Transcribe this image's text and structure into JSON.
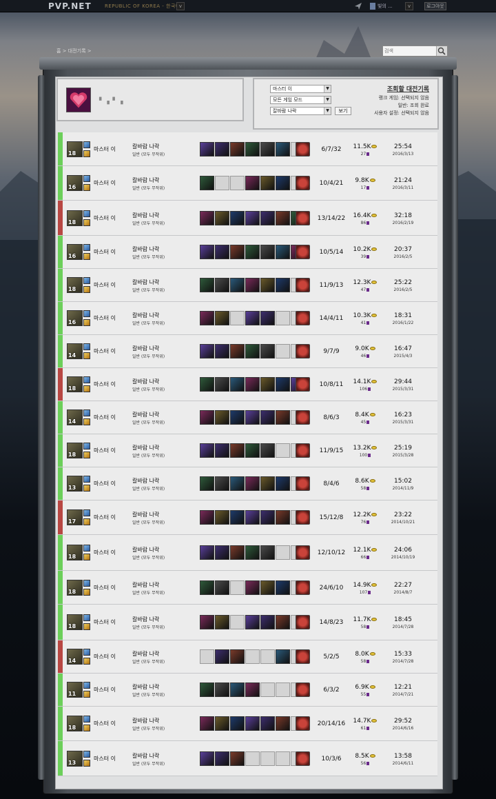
{
  "header": {
    "logo": "PVP.NET",
    "region": "REPUBLIC OF KOREA - 한국어",
    "region_dd": "v",
    "user_name": "빛의 ...",
    "user_dd": "v",
    "logout": "로그아웃"
  },
  "breadcrumb": "홈 > 대전기록 >",
  "search": {
    "placeholder": "검색"
  },
  "summoner": {
    "name": "▘▗▝ ▗"
  },
  "filters": {
    "champion": "마스터 이",
    "game_mode": "모든 게임 모드",
    "map": "칼바람 나락",
    "view_button": "보기",
    "title": "조회할 대전기록",
    "ranked": "랭크 게임: 선택되지 않음",
    "normal": "일반: 조회 완료",
    "custom": "사용자 설정: 선택되지 않음"
  },
  "colors": {
    "win": "#6ccf5a",
    "loss": "#b84743",
    "accent": "#8a6f10"
  },
  "matches": [
    {
      "result": "win",
      "level": "18",
      "champion": "마스터 이",
      "map": "칼바람 나락",
      "mode": "일반 (모두 무작위)",
      "kda": "6/7/32",
      "gold": "11.5K",
      "cs": "27",
      "time": "25:54",
      "date": "2016/3/13",
      "items": [
        1,
        1,
        1,
        1,
        1,
        1,
        0
      ]
    },
    {
      "result": "win",
      "level": "16",
      "champion": "마스터 이",
      "map": "칼바람 나락",
      "mode": "일반 (모두 무작위)",
      "kda": "10/4/21",
      "gold": "9.8K",
      "cs": "17",
      "time": "21:24",
      "date": "2016/3/11",
      "items": [
        1,
        0,
        0,
        1,
        1,
        1,
        0
      ]
    },
    {
      "result": "loss",
      "level": "18",
      "champion": "마스터 이",
      "map": "칼바람 나락",
      "mode": "일반 (모두 무작위)",
      "kda": "13/14/22",
      "gold": "16.4K",
      "cs": "86",
      "time": "32:18",
      "date": "2016/2/19",
      "items": [
        1,
        1,
        1,
        1,
        1,
        1,
        1
      ]
    },
    {
      "result": "win",
      "level": "16",
      "champion": "마스터 이",
      "map": "칼바람 나락",
      "mode": "일반 (모두 무작위)",
      "kda": "10/5/14",
      "gold": "10.2K",
      "cs": "39",
      "time": "20:37",
      "date": "2016/2/5",
      "items": [
        1,
        1,
        1,
        1,
        1,
        1,
        1
      ]
    },
    {
      "result": "win",
      "level": "18",
      "champion": "마스터 이",
      "map": "칼바람 나락",
      "mode": "일반 (모두 무작위)",
      "kda": "11/9/13",
      "gold": "12.3K",
      "cs": "47",
      "time": "25:22",
      "date": "2016/2/5",
      "items": [
        1,
        1,
        1,
        1,
        1,
        1,
        0
      ]
    },
    {
      "result": "win",
      "level": "16",
      "champion": "마스터 이",
      "map": "칼바람 나락",
      "mode": "일반 (모두 무작위)",
      "kda": "14/4/11",
      "gold": "10.3K",
      "cs": "41",
      "time": "18:31",
      "date": "2016/1/22",
      "items": [
        1,
        1,
        0,
        1,
        1,
        0,
        0
      ]
    },
    {
      "result": "win",
      "level": "14",
      "champion": "마스터 이",
      "map": "칼바람 나락",
      "mode": "일반 (모두 무작위)",
      "kda": "9/7/9",
      "gold": "9.0K",
      "cs": "46",
      "time": "16:47",
      "date": "2015/4/3",
      "items": [
        1,
        1,
        1,
        1,
        1,
        0,
        0
      ]
    },
    {
      "result": "loss",
      "level": "18",
      "champion": "마스터 이",
      "map": "칼바람 나락",
      "mode": "일반 (모두 무작위)",
      "kda": "10/8/11",
      "gold": "14.1K",
      "cs": "106",
      "time": "29:44",
      "date": "2015/3/31",
      "items": [
        1,
        1,
        1,
        1,
        1,
        1,
        1
      ]
    },
    {
      "result": "win",
      "level": "14",
      "champion": "마스터 이",
      "map": "칼바람 나락",
      "mode": "일반 (모두 무작위)",
      "kda": "8/6/3",
      "gold": "8.4K",
      "cs": "45",
      "time": "16:23",
      "date": "2015/3/31",
      "items": [
        1,
        1,
        1,
        1,
        1,
        1,
        0
      ]
    },
    {
      "result": "win",
      "level": "18",
      "champion": "마스터 이",
      "map": "칼바람 나락",
      "mode": "일반 (모두 무작위)",
      "kda": "11/9/15",
      "gold": "13.2K",
      "cs": "100",
      "time": "25:19",
      "date": "2015/3/28",
      "items": [
        1,
        1,
        1,
        1,
        1,
        0,
        0
      ]
    },
    {
      "result": "win",
      "level": "13",
      "champion": "마스터 이",
      "map": "칼바람 나락",
      "mode": "일반 (모두 무작위)",
      "kda": "8/4/6",
      "gold": "8.6K",
      "cs": "58",
      "time": "15:02",
      "date": "2014/11/9",
      "items": [
        1,
        1,
        1,
        1,
        1,
        1,
        0
      ]
    },
    {
      "result": "loss",
      "level": "17",
      "champion": "마스터 이",
      "map": "칼바람 나락",
      "mode": "일반 (모두 무작위)",
      "kda": "15/12/8",
      "gold": "12.2K",
      "cs": "76",
      "time": "23:22",
      "date": "2014/10/21",
      "items": [
        1,
        1,
        1,
        1,
        1,
        1,
        0
      ]
    },
    {
      "result": "win",
      "level": "18",
      "champion": "마스터 이",
      "map": "칼바람 나락",
      "mode": "일반 (모두 무작위)",
      "kda": "12/10/12",
      "gold": "12.1K",
      "cs": "66",
      "time": "24:06",
      "date": "2014/10/19",
      "items": [
        1,
        1,
        1,
        1,
        1,
        0,
        0
      ]
    },
    {
      "result": "win",
      "level": "18",
      "champion": "마스터 이",
      "map": "칼바람 나락",
      "mode": "일반 (모두 무작위)",
      "kda": "24/6/10",
      "gold": "14.9K",
      "cs": "107",
      "time": "22:27",
      "date": "2014/8/7",
      "items": [
        1,
        1,
        0,
        1,
        1,
        1,
        0
      ]
    },
    {
      "result": "win",
      "level": "18",
      "champion": "마스터 이",
      "map": "칼바람 나락",
      "mode": "일반 (모두 무작위)",
      "kda": "14/8/23",
      "gold": "11.7K",
      "cs": "58",
      "time": "18:45",
      "date": "2014/7/28",
      "items": [
        1,
        1,
        0,
        1,
        1,
        1,
        0
      ]
    },
    {
      "result": "loss",
      "level": "14",
      "champion": "마스터 이",
      "map": "칼바람 나락",
      "mode": "일반 (모두 무작위)",
      "kda": "5/2/5",
      "gold": "8.0K",
      "cs": "58",
      "time": "15:33",
      "date": "2014/7/28",
      "items": [
        0,
        1,
        1,
        0,
        0,
        1,
        0
      ]
    },
    {
      "result": "win",
      "level": "11",
      "champion": "마스터 이",
      "map": "칼바람 나락",
      "mode": "일반 (모두 무작위)",
      "kda": "6/3/2",
      "gold": "6.9K",
      "cs": "55",
      "time": "12:21",
      "date": "2014/7/21",
      "items": [
        1,
        1,
        1,
        1,
        0,
        0,
        0
      ]
    },
    {
      "result": "win",
      "level": "18",
      "champion": "마스터 이",
      "map": "칼바람 나락",
      "mode": "일반 (모두 무작위)",
      "kda": "20/14/16",
      "gold": "14.7K",
      "cs": "61",
      "time": "29:52",
      "date": "2014/6/16",
      "items": [
        1,
        1,
        1,
        1,
        1,
        1,
        0
      ]
    },
    {
      "result": "win",
      "level": "13",
      "champion": "마스터 이",
      "map": "칼바람 나락",
      "mode": "일반 (모두 무작위)",
      "kda": "10/3/6",
      "gold": "8.5K",
      "cs": "56",
      "time": "13:58",
      "date": "2014/6/11",
      "items": [
        1,
        1,
        1,
        0,
        0,
        0,
        0
      ]
    }
  ]
}
